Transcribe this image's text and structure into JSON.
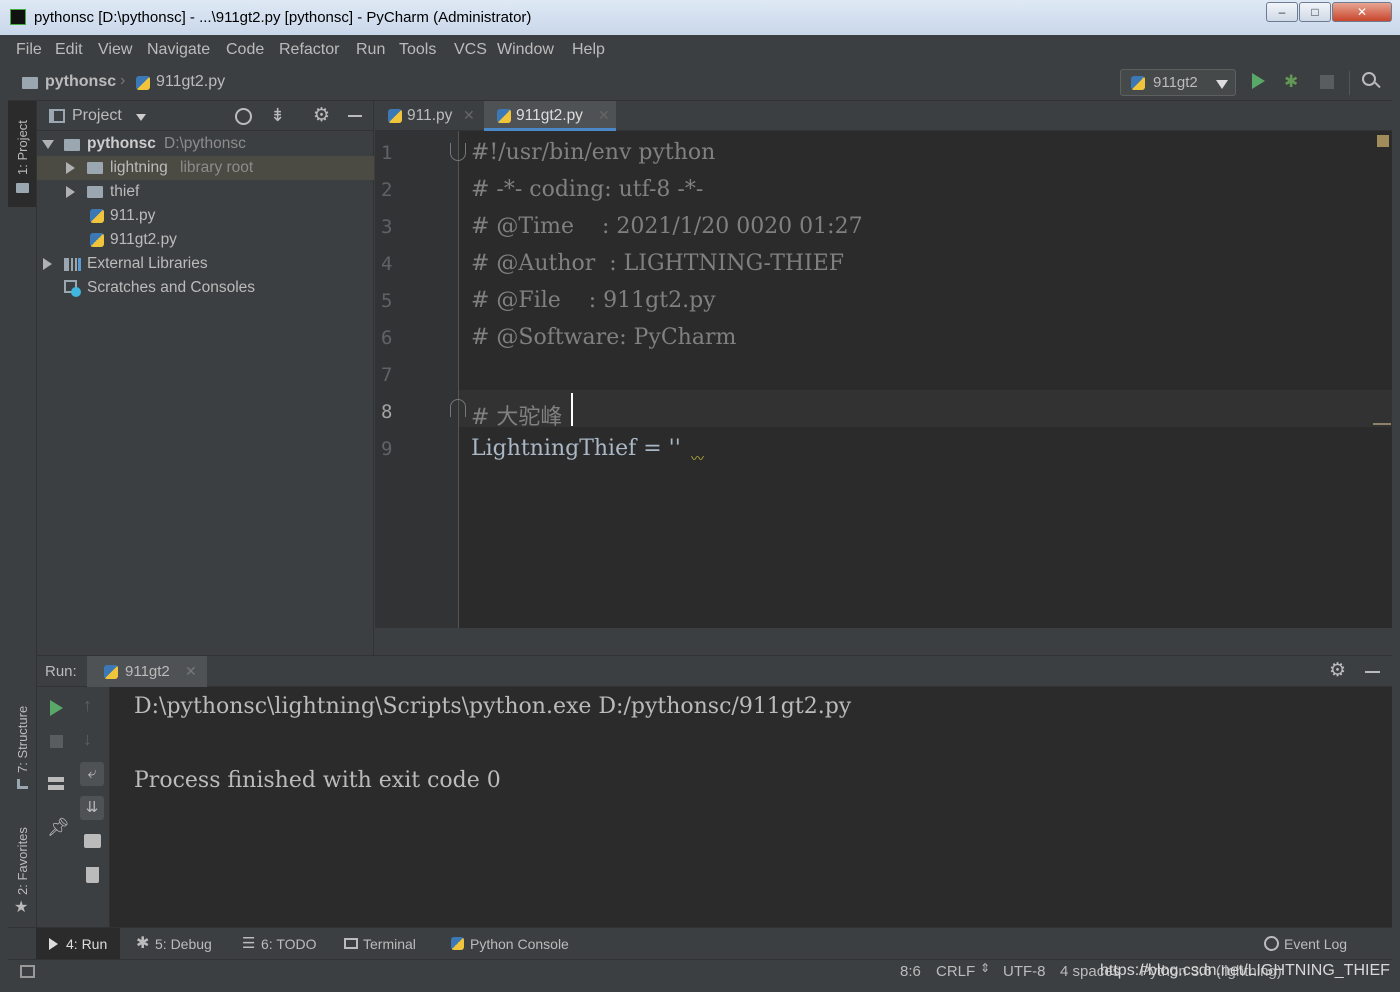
{
  "window": {
    "title": "pythonsc [D:\\pythonsc] - ...\\911gt2.py [pythonsc] - PyCharm (Administrator)",
    "minimize": "–",
    "maximize": "□",
    "close": "✕"
  },
  "menu": [
    "File",
    "Edit",
    "View",
    "Navigate",
    "Code",
    "Refactor",
    "Run",
    "Tools",
    "VCS",
    "Window",
    "Help"
  ],
  "breadcrumb": {
    "project": "pythonsc",
    "file": "911gt2.py"
  },
  "run_config": {
    "name": "911gt2"
  },
  "side_tabs": {
    "project": "1: Project",
    "structure": "7: Structure",
    "favorites": "2: Favorites"
  },
  "project_panel": {
    "title": "Project",
    "tree": [
      {
        "name": "pythonsc",
        "hint": "D:\\pythonsc"
      },
      {
        "name": "lightning",
        "hint": "library root"
      },
      {
        "name": "thief",
        "hint": ""
      },
      {
        "name": "911.py",
        "hint": ""
      },
      {
        "name": "911gt2.py",
        "hint": ""
      },
      {
        "name": "External Libraries",
        "hint": ""
      },
      {
        "name": "Scratches and Consoles",
        "hint": ""
      }
    ]
  },
  "editor": {
    "tabs": [
      {
        "label": "911.py",
        "active": false
      },
      {
        "label": "911gt2.py",
        "active": true
      }
    ],
    "lines": [
      {
        "n": "1",
        "text": "#!/usr/bin/env python"
      },
      {
        "n": "2",
        "text": "# -*- coding: utf-8 -*-"
      },
      {
        "n": "3",
        "text": "# @Time    : 2021/1/20 0020 01:27"
      },
      {
        "n": "4",
        "text": "# @Author  : LIGHTNING-THIEF"
      },
      {
        "n": "5",
        "text": "# @File    : 911gt2.py"
      },
      {
        "n": "6",
        "text": "# @Software: PyCharm"
      },
      {
        "n": "7",
        "text": ""
      },
      {
        "n": "8",
        "text": "# 大驼峰"
      },
      {
        "n": "9",
        "text": "LightningThief = ''"
      }
    ],
    "current_line": 8
  },
  "run_panel": {
    "label": "Run:",
    "tab": "911gt2",
    "output": [
      "D:\\pythonsc\\lightning\\Scripts\\python.exe D:/pythonsc/911gt2.py",
      "",
      "Process finished with exit code 0"
    ]
  },
  "bottom_tools": {
    "run": "4: Run",
    "debug": "5: Debug",
    "todo": "6: TODO",
    "terminal": "Terminal",
    "python_console": "Python Console",
    "event_log": "Event Log"
  },
  "status": {
    "position": "8:6",
    "line_sep": "CRLF",
    "encoding": "UTF-8",
    "indent": "4 spaces",
    "interpreter": "Python 3.6 (lightning)"
  },
  "watermark": "https://blog.csdn.net/LIGHTNING_THIEF",
  "colors": {
    "background": "#3c3f41",
    "editor_bg": "#2b2b2b",
    "comment": "#808080",
    "code_text": "#a9b7c6",
    "string": "#6a8759",
    "run_green": "#59a869",
    "debug_green": "#629755"
  }
}
